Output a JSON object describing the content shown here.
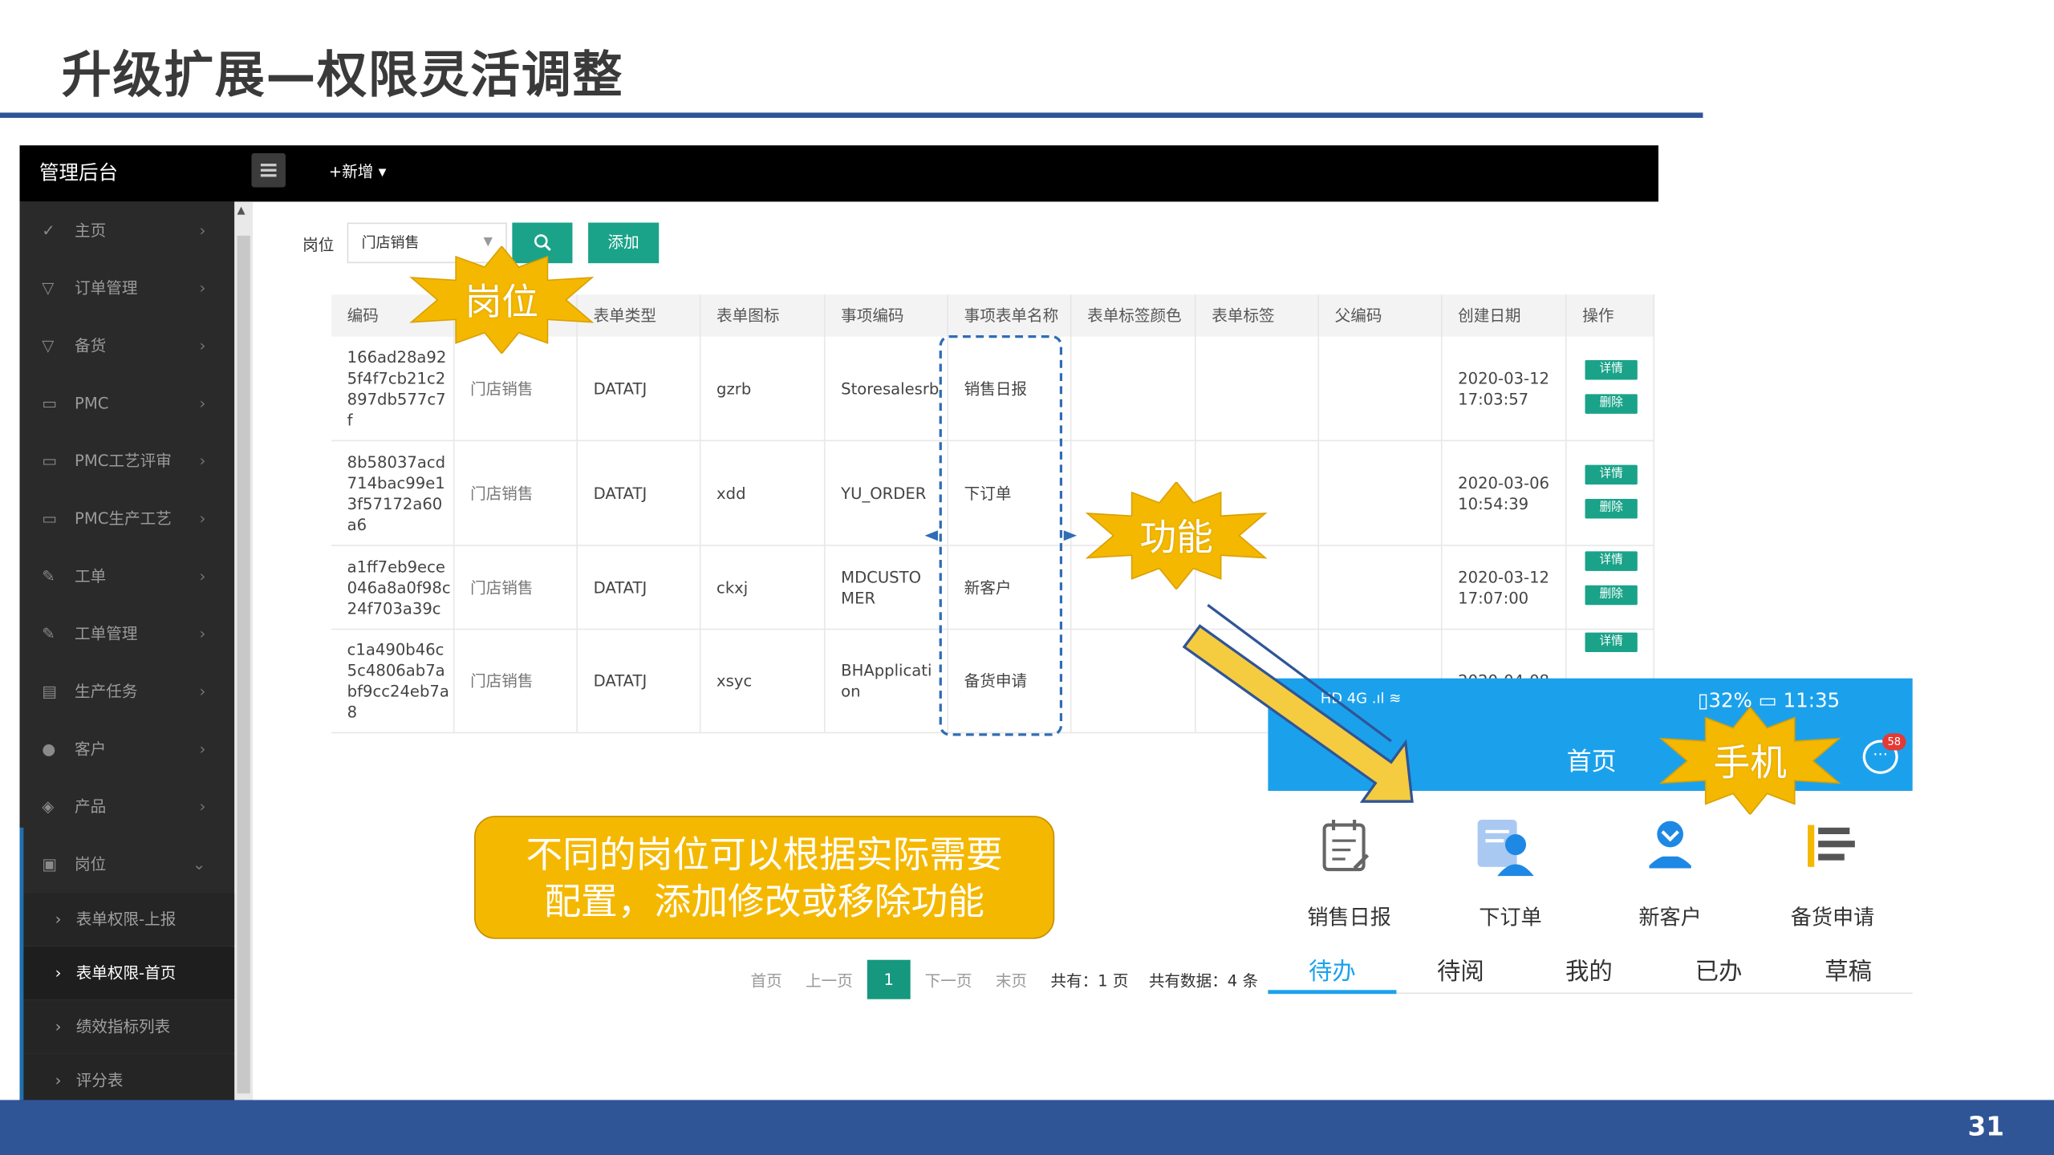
{
  "slide": {
    "title": "升级扩展—权限灵活调整",
    "page_number": "31"
  },
  "admin": {
    "app_title": "管理后台",
    "new_label": "+新增 ▾",
    "sidebar": [
      {
        "icon": "send-icon",
        "label": "主页"
      },
      {
        "icon": "filter-icon",
        "label": "订单管理"
      },
      {
        "icon": "filter-icon",
        "label": "备货"
      },
      {
        "icon": "folder-icon",
        "label": "PMC"
      },
      {
        "icon": "folder-icon",
        "label": "PMC工艺评审"
      },
      {
        "icon": "folder-icon",
        "label": "PMC生产工艺"
      },
      {
        "icon": "edit-icon",
        "label": "工单"
      },
      {
        "icon": "edit-icon",
        "label": "工单管理"
      },
      {
        "icon": "task-icon",
        "label": "生产任务"
      },
      {
        "icon": "user-icon",
        "label": "客户"
      },
      {
        "icon": "cube-icon",
        "label": "产品"
      },
      {
        "icon": "id-card-icon",
        "label": "岗位"
      }
    ],
    "sub_items": [
      "表单权限-上报",
      "表单权限-首页",
      "绩效指标列表",
      "评分表"
    ],
    "filter": {
      "label": "岗位",
      "select_value": "门店销售",
      "search_icon": "search-icon",
      "add_label": "添加"
    },
    "table": {
      "headers": [
        "编码",
        "",
        "表单类型",
        "表单图标",
        "事项编码",
        "事项表单名称",
        "表单标签颜色",
        "表单标签",
        "父编码",
        "创建日期",
        "操作"
      ],
      "rows": [
        {
          "id": "166ad28a92\n5f4f7cb21c2\n897db577c7\nf",
          "post": "门店销售",
          "type": "DATATJ",
          "icon": "gzrb",
          "code": "Storesalesrb",
          "name": "销售日报",
          "date": "2020-03-12\n17:03:57"
        },
        {
          "id": "8b58037acd\n714bac99e1\n3f57172a60\na6",
          "post": "门店销售",
          "type": "DATATJ",
          "icon": "xdd",
          "code": "YU_ORDER",
          "name": "下订单",
          "date": "2020-03-06\n10:54:39"
        },
        {
          "id": "a1ff7eb9ece\n046a8a0f98c\n24f703a39c",
          "post": "门店销售",
          "type": "DATATJ",
          "icon": "ckxj",
          "code": "MDCUSTO\nMER",
          "name": "新客户",
          "date": "2020-03-12\n17:07:00"
        },
        {
          "id": "c1a490b46c\n5c4806ab7a\nbf9cc24eb7a\n8",
          "post": "门店销售",
          "type": "DATATJ",
          "icon": "xsyc",
          "code": "BHApplicati\non",
          "name": "备货申请",
          "date": "2020-04-08"
        }
      ],
      "detail_label": "详情",
      "delete_label": "删除"
    },
    "pagination": {
      "first": "首页",
      "prev": "上一页",
      "current": "1",
      "next": "下一页",
      "last": "末页",
      "total_pages": "共有：1 页",
      "total_records": "共有数据：4 条"
    }
  },
  "phone": {
    "status_left": "HD 4G .ıl ≋",
    "status_right": "▯32% ▭ 11:35",
    "title": "首页",
    "badge": "58",
    "functions": [
      {
        "label": "销售日报",
        "icon": "report-icon"
      },
      {
        "label": "下订单",
        "icon": "order-icon"
      },
      {
        "label": "新客户",
        "icon": "new-customer-icon"
      },
      {
        "label": "备货申请",
        "icon": "stock-request-icon"
      }
    ],
    "tabs": [
      "待办",
      "待阅",
      "我的",
      "已办",
      "草稿"
    ],
    "colors": {
      "bar": "#1ba1ec"
    }
  },
  "annotations": {
    "post": "岗位",
    "function": "功能",
    "phone": "手机",
    "callout": "不同的岗位可以根据实际需要\n配置，添加修改或移除功能"
  }
}
